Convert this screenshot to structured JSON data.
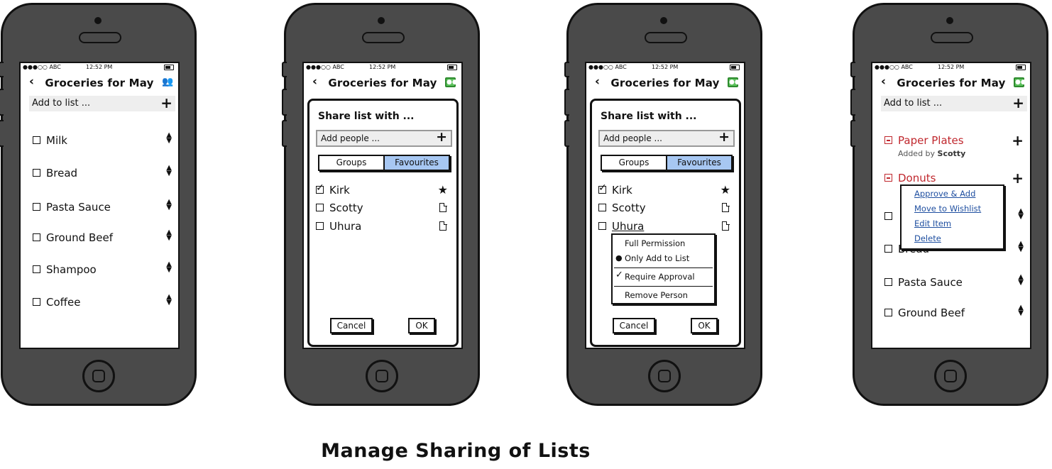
{
  "status_bar": {
    "carrier": "●●●○○ ABC",
    "time": "12:52 PM"
  },
  "list_title": "Groceries for May",
  "back_icon": "‹",
  "add_bar": {
    "label": "Add to list ...",
    "plus": "+"
  },
  "phone1": {
    "items": [
      "Milk",
      "Bread",
      "Pasta Sauce",
      "Ground Beef",
      "Shampoo",
      "Coffee"
    ]
  },
  "dialog": {
    "title": "Share list with ...",
    "add_people": "Add people ...",
    "plus": "+",
    "tabs": [
      "Groups",
      "Favourites"
    ],
    "active_tab": "Favourites",
    "people": [
      {
        "name": "Kirk",
        "checked": true,
        "icon": "star-icon"
      },
      {
        "name": "Scotty",
        "checked": false,
        "icon": "document-icon"
      },
      {
        "name": "Uhura",
        "checked": false,
        "icon": "document-icon"
      }
    ],
    "cancel": "Cancel",
    "ok": "OK"
  },
  "permission_menu": {
    "items": [
      "Full Permission",
      "Only Add to List",
      "Require Approval",
      "Remove Person"
    ],
    "radio_selected": "Only Add to List",
    "checked": "Require Approval"
  },
  "phone4": {
    "pending": [
      {
        "name": "Paper Plates",
        "added_by_label": "Added by",
        "added_by": "Scotty"
      },
      {
        "name": "Donuts"
      }
    ],
    "actions": [
      "Approve & Add",
      "Move to Wishlist",
      "Edit Item",
      "Delete"
    ],
    "items": [
      "Bread",
      "Pasta Sauce",
      "Ground Beef"
    ]
  },
  "caption": "Manage Sharing of Lists",
  "colors": {
    "pending_red": "#c0282e",
    "tab_active": "#a7c7f2",
    "share_green": "#5cc15c",
    "link_blue": "#1f4fa0"
  }
}
